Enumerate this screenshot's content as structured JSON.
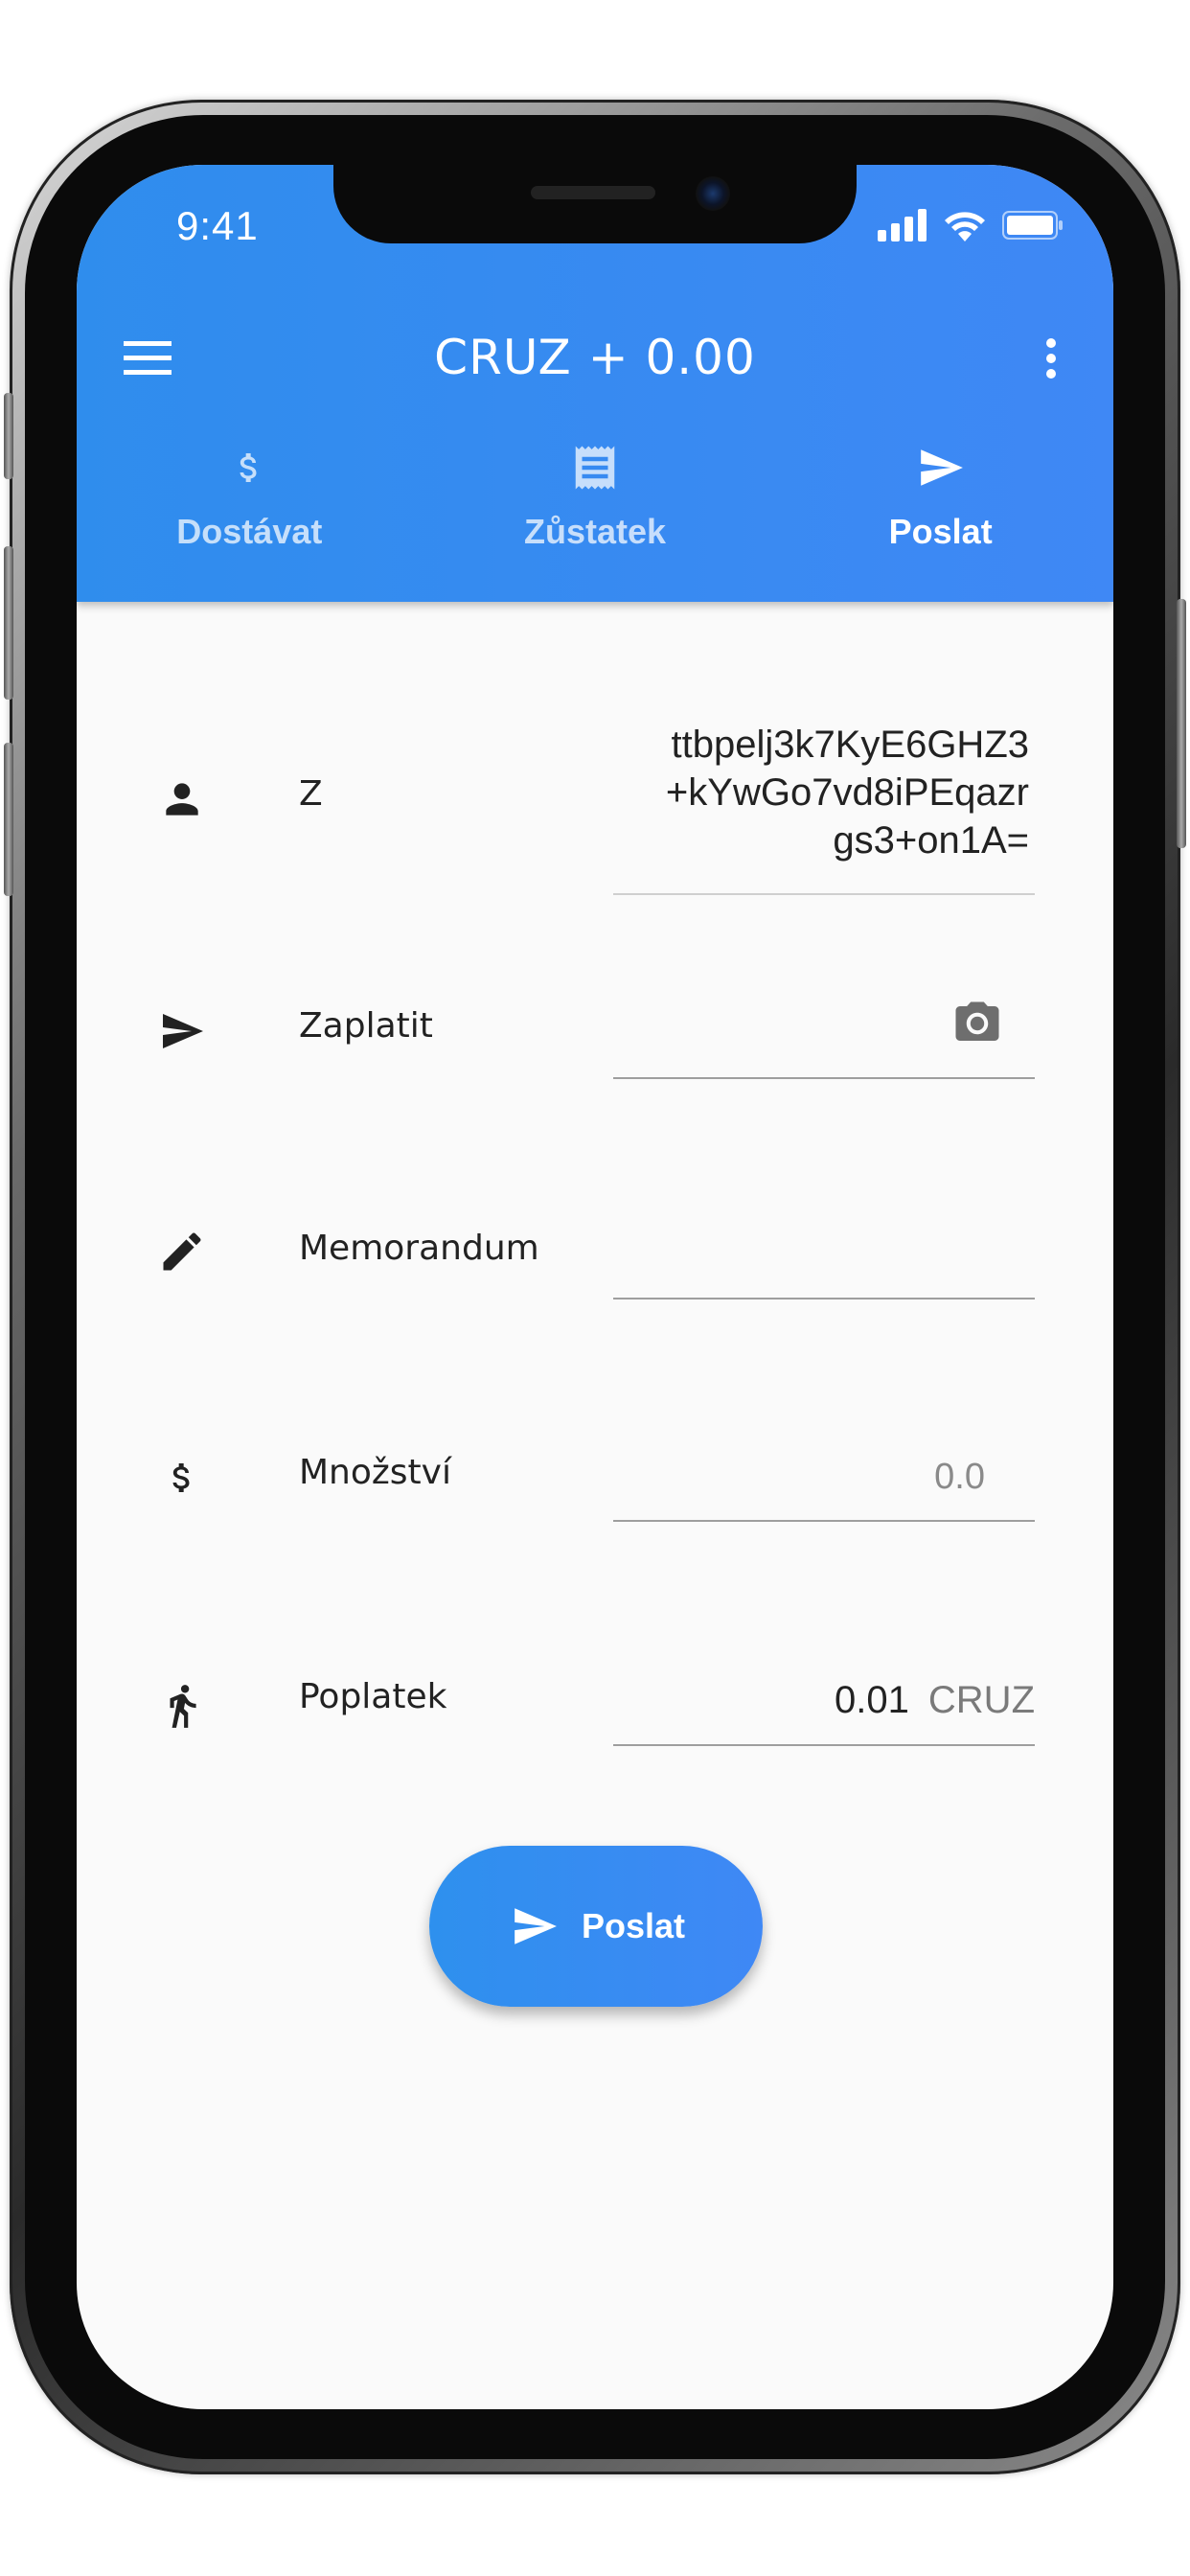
{
  "status_bar": {
    "time": "9:41"
  },
  "toolbar": {
    "title": "CRUZ + 0.00"
  },
  "tabs": [
    {
      "label": "Dostávat",
      "icon": "dollar-icon",
      "active": false
    },
    {
      "label": "Zůstatek",
      "icon": "receipt-icon",
      "active": false
    },
    {
      "label": "Poslat",
      "icon": "send-icon",
      "active": true
    }
  ],
  "form": {
    "from": {
      "label": "Z",
      "icon": "person-icon",
      "value_lines": [
        "ttbpelj3k7KyE6GHZ3",
        "+kYwGo7vd8iPEqazr",
        "gs3+on1A="
      ]
    },
    "pay_to": {
      "label": "Zaplatit",
      "icon": "send-icon",
      "value": "",
      "action_icon": "camera-icon"
    },
    "memo": {
      "label": "Memorandum",
      "icon": "pencil-icon",
      "value": ""
    },
    "amount": {
      "label": "Množství",
      "icon": "dollar-icon",
      "placeholder": "0.0"
    },
    "fee": {
      "label": "Poplatek",
      "icon": "walking-icon",
      "value": "0.01",
      "unit": "CRUZ"
    }
  },
  "send_button": {
    "label": "Poslat",
    "icon": "send-icon"
  },
  "colors": {
    "primary": "#3f88f5",
    "primary_start": "#2f8ded",
    "background": "#fafafa",
    "text": "#222222"
  }
}
